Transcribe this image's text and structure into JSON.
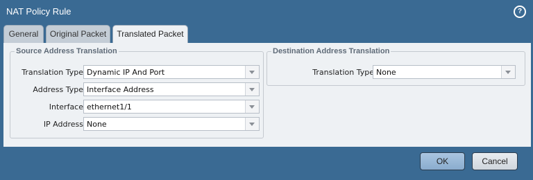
{
  "dialog": {
    "title": "NAT Policy Rule",
    "help_icon": "?"
  },
  "tabs": [
    {
      "label": "General"
    },
    {
      "label": "Original Packet"
    },
    {
      "label": "Translated Packet",
      "active": true
    }
  ],
  "source": {
    "legend": "Source Address Translation",
    "fields": [
      {
        "label": "Translation Type",
        "value": "Dynamic IP And Port"
      },
      {
        "label": "Address Type",
        "value": "Interface Address"
      },
      {
        "label": "Interface",
        "value": "ethernet1/1"
      },
      {
        "label": "IP Address",
        "value": "None"
      }
    ]
  },
  "destination": {
    "legend": "Destination Address Translation",
    "fields": [
      {
        "label": "Translation Type",
        "value": "None"
      }
    ]
  },
  "buttons": {
    "ok": "OK",
    "cancel": "Cancel"
  },
  "colors": {
    "title_bar": "#3a6a93",
    "panel": "#eef1f4",
    "tab_inactive": "#c4cdd6",
    "ok_button": "#9ab8d6"
  }
}
